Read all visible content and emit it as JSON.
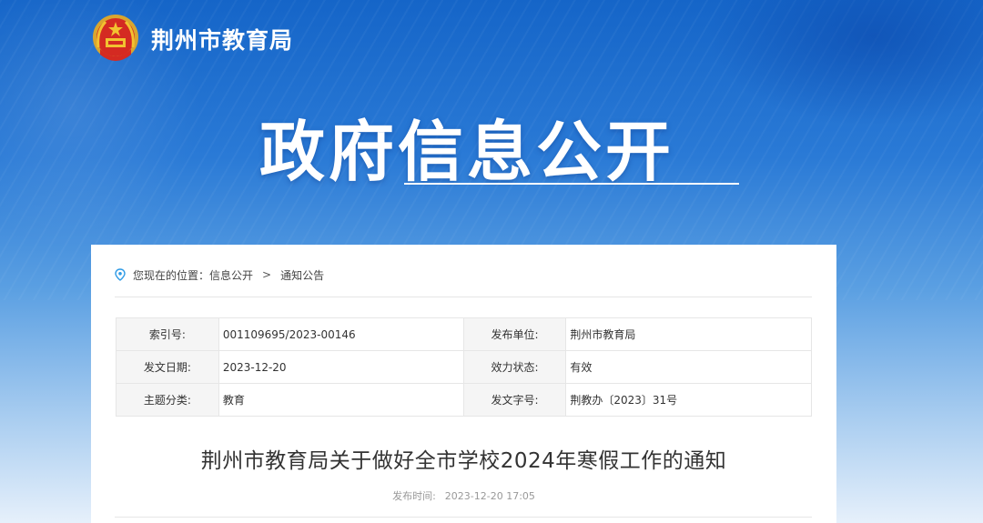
{
  "header": {
    "site_title": "荆州市教育局",
    "emblem_icon": "national-emblem-icon"
  },
  "hero": {
    "title": "政府信息公开"
  },
  "breadcrumb": {
    "prefix": "您现在的位置：",
    "items": [
      "信息公开",
      "通知公告"
    ],
    "separator": ">"
  },
  "meta": {
    "rows": [
      {
        "l1": "索引号:",
        "v1": "001109695/2023-00146",
        "l2": "发布单位:",
        "v2": "荆州市教育局"
      },
      {
        "l1": "发文日期:",
        "v1": "2023-12-20",
        "l2": "效力状态:",
        "v2": "有效"
      },
      {
        "l1": "主题分类:",
        "v1": "教育",
        "l2": "发文字号:",
        "v2": "荆教办〔2023〕31号"
      }
    ]
  },
  "article": {
    "title": "荆州市教育局关于做好全市学校2024年寒假工作的通知",
    "publish_label": "发布时间:",
    "publish_time": "2023-12-20 17:05"
  },
  "colors": {
    "hero_blue": "#1565c8",
    "label_bg": "#f5f5f5",
    "border": "#e6e6e6",
    "location_icon": "#2e9be6"
  }
}
